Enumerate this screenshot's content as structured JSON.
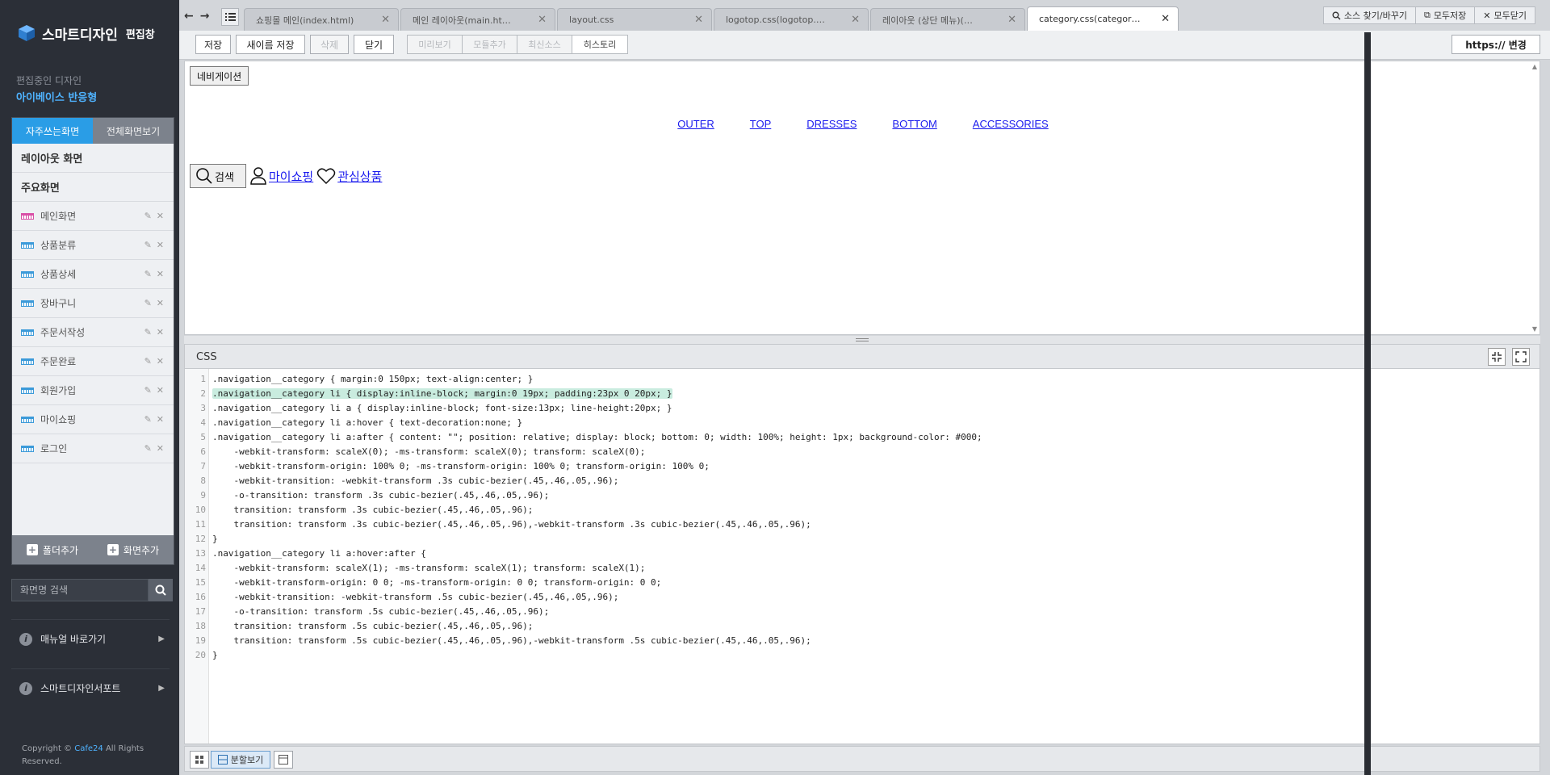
{
  "sidebar": {
    "brand": "스마트디자인",
    "brand_sub": "편집창",
    "editing_label": "편집중인 디자인",
    "editing_name": "아이베이스 반응형",
    "tabs": [
      "자주쓰는화면",
      "전체화면보기"
    ],
    "sections": [
      "레이아웃 화면",
      "주요화면"
    ],
    "items": [
      {
        "label": "메인화면"
      },
      {
        "label": "상품분류"
      },
      {
        "label": "상품상세"
      },
      {
        "label": "장바구니"
      },
      {
        "label": "주문서작성"
      },
      {
        "label": "주문완료"
      },
      {
        "label": "회원가입"
      },
      {
        "label": "마이쇼핑"
      },
      {
        "label": "로그인"
      }
    ],
    "add_folder": "폴더추가",
    "add_screen": "화면추가",
    "search_placeholder": "화면명 검색",
    "links": [
      "매뉴얼 바로가기",
      "스마트디자인서포트"
    ],
    "copyright_prefix": "Copyright ©",
    "copyright_brand": "Cafe24",
    "copyright_suffix": "All Rights Reserved."
  },
  "tabs": [
    {
      "title": "쇼핑몰 메인(index.html)"
    },
    {
      "title": "메인 레이아웃(main.ht…"
    },
    {
      "title": "layout.css"
    },
    {
      "title": "logotop.css(logotop.…"
    },
    {
      "title": "레이아웃 (상단 메뉴)(…"
    },
    {
      "title": "category.css(categor…"
    }
  ],
  "top_buttons": [
    "소스 찾기/바꾸기",
    "모두저장",
    "모두닫기"
  ],
  "toolbar": {
    "save": "저장",
    "save_as": "새이름 저장",
    "delete": "삭제",
    "close": "닫기",
    "group": [
      "미리보기",
      "모듈추가",
      "최신소스",
      "히스토리"
    ],
    "https": "https:// 변경"
  },
  "preview": {
    "nav_button": "네비게이션",
    "categories": [
      "OUTER",
      "TOP",
      "DRESSES",
      "BOTTOM",
      "ACCESSORIES"
    ],
    "search": "검색",
    "myshop": "마이쇼핑",
    "wishlist": "관심상품"
  },
  "editor": {
    "language": "CSS",
    "lines": [
      ".navigation__category { margin:0 150px; text-align:center; }",
      ".navigation__category li { display:inline-block; margin:0 19px; padding:23px 0 20px; }",
      ".navigation__category li a { display:inline-block; font-size:13px; line-height:20px; }",
      ".navigation__category li a:hover { text-decoration:none; }",
      ".navigation__category li a:after { content: \"\"; position: relative; display: block; bottom: 0; width: 100%; height: 1px; background-color: #000;",
      "    -webkit-transform: scaleX(0); -ms-transform: scaleX(0); transform: scaleX(0);",
      "    -webkit-transform-origin: 100% 0; -ms-transform-origin: 100% 0; transform-origin: 100% 0;",
      "    -webkit-transition: -webkit-transform .3s cubic-bezier(.45,.46,.05,.96);",
      "    -o-transition: transform .3s cubic-bezier(.45,.46,.05,.96);",
      "    transition: transform .3s cubic-bezier(.45,.46,.05,.96);",
      "    transition: transform .3s cubic-bezier(.45,.46,.05,.96),-webkit-transform .3s cubic-bezier(.45,.46,.05,.96);",
      "}",
      ".navigation__category li a:hover:after {",
      "    -webkit-transform: scaleX(1); -ms-transform: scaleX(1); transform: scaleX(1);",
      "    -webkit-transform-origin: 0 0; -ms-transform-origin: 0 0; transform-origin: 0 0;",
      "    -webkit-transition: -webkit-transform .5s cubic-bezier(.45,.46,.05,.96);",
      "    -o-transition: transform .5s cubic-bezier(.45,.46,.05,.96);",
      "    transition: transform .5s cubic-bezier(.45,.46,.05,.96);",
      "    transition: transform .5s cubic-bezier(.45,.46,.05,.96),-webkit-transform .5s cubic-bezier(.45,.46,.05,.96);",
      "}"
    ],
    "highlighted_line": 2
  },
  "statusbar": {
    "split_view": "분할보기"
  },
  "colors": {
    "accent": "#2a9de6",
    "sidebar_bg": "#2b2f37",
    "highlight": "#c9ecdf"
  }
}
